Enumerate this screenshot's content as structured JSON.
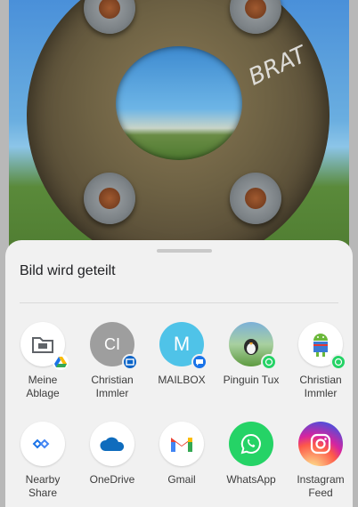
{
  "share_sheet": {
    "title": "Bild wird geteilt",
    "direct_targets": [
      {
        "label_line1": "Meine",
        "label_line2": "Ablage",
        "icon": "google-drive-folder-icon",
        "badge": "google-drive-icon"
      },
      {
        "label_line1": "Christian",
        "label_line2": "Immler",
        "initials": "CI",
        "badge": "outlook-icon"
      },
      {
        "label_line1": "MAILBOX",
        "label_line2": "",
        "initials": "M",
        "badge": "messages-icon"
      },
      {
        "label_line1": "Pinguin Tux",
        "label_line2": "",
        "icon": "contact-photo-icon",
        "badge": "whatsapp-icon"
      },
      {
        "label_line1": "Christian",
        "label_line2": "Immler",
        "icon": "android-robot-icon",
        "badge": "whatsapp-icon"
      }
    ],
    "apps": [
      {
        "label_line1": "Nearby",
        "label_line2": "Share",
        "icon": "nearby-share-icon"
      },
      {
        "label_line1": "OneDrive",
        "label_line2": "",
        "icon": "onedrive-icon"
      },
      {
        "label_line1": "Gmail",
        "label_line2": "",
        "icon": "gmail-icon"
      },
      {
        "label_line1": "WhatsApp",
        "label_line2": "",
        "icon": "whatsapp-icon"
      },
      {
        "label_line1": "Instagram",
        "label_line2": "Feed",
        "icon": "instagram-icon"
      }
    ]
  },
  "background_photo": {
    "graffiti": "BRAT"
  },
  "colors": {
    "sheet_bg": "#f1f1f1",
    "ci_avatar": "#9e9e9e",
    "mailbox_avatar": "#4fc3e8",
    "whatsapp": "#25d366",
    "onedrive": "#0f6cbd",
    "outlook": "#0a64c8"
  }
}
